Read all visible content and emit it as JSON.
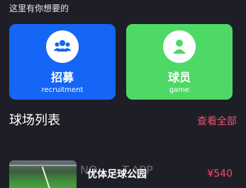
{
  "intro_text": "这里有你想要的",
  "cards": [
    {
      "title": "招募",
      "subtitle": "recruitment",
      "icon": "group-icon",
      "color": "#1565f6"
    },
    {
      "title": "球员",
      "subtitle": "game",
      "icon": "person-icon",
      "color": "#4ed966"
    }
  ],
  "section": {
    "title": "球场列表",
    "view_all": "查看全部"
  },
  "fields": [
    {
      "name": "优体足球公园",
      "price": "¥540"
    }
  ],
  "watermark": "NO... ...T.APP",
  "colors": {
    "background": "#1e1f26",
    "accent": "#f0506e"
  }
}
